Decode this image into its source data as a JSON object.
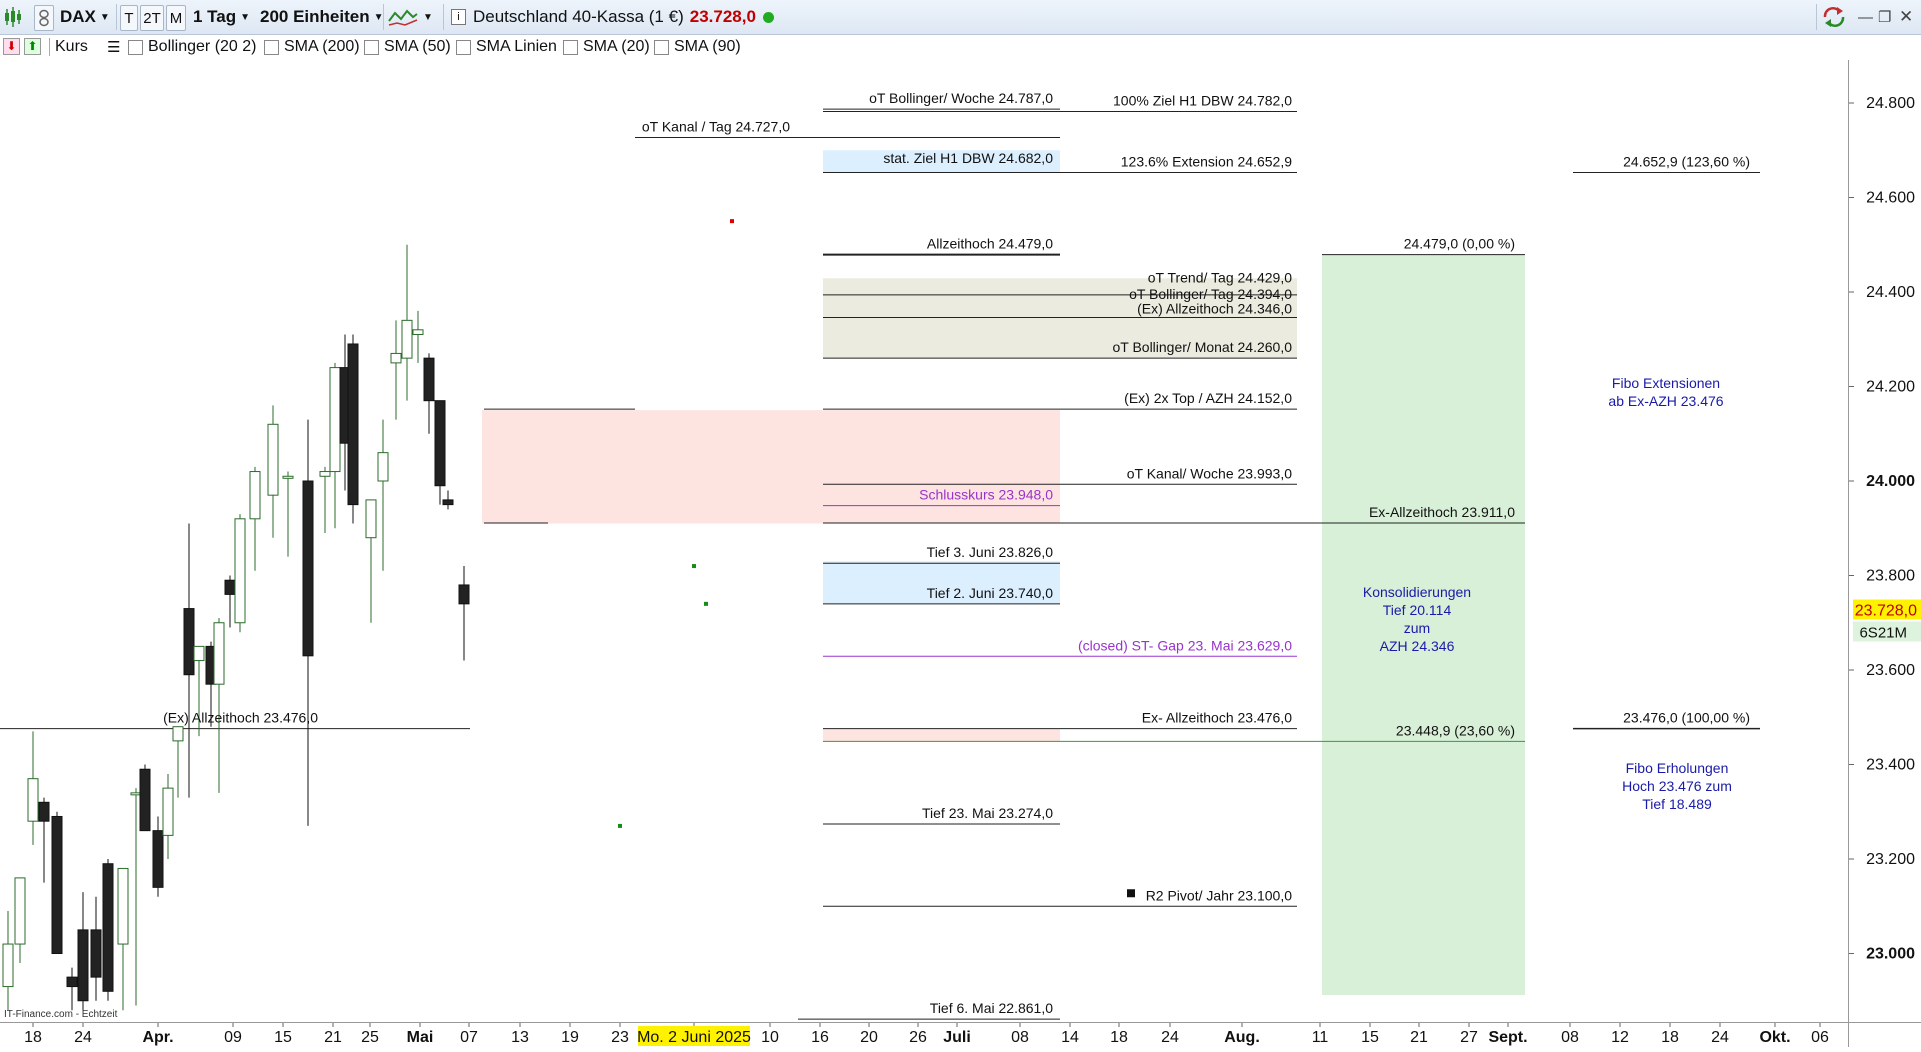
{
  "toolbar": {
    "symbol": "DAX",
    "btn_t": "T",
    "btn_2t": "2T",
    "btn_m": "M",
    "period": "1 Tag",
    "units": "200 Einheiten",
    "instrument": "Deutschland 40-Kassa (1 €)",
    "price": "23.728,0",
    "price_color": "#c00000",
    "status_color": "#22aa22"
  },
  "indicators": {
    "kurs": "Kurs",
    "items": [
      "Bollinger (20 2)",
      "SMA (200)",
      "SMA (50)",
      "SMA Linien",
      "SMA (20)",
      "SMA (90)"
    ]
  },
  "price_axis": {
    "ticks": [
      "24.800",
      "24.600",
      "24.400",
      "24.200",
      "24.000",
      "23.800",
      "23.600",
      "23.400",
      "23.200",
      "23.000"
    ],
    "bold_ticks": [
      "24.000",
      "23.000"
    ],
    "current_price": "23.728,0",
    "countdown": "6S21M"
  },
  "date_axis": {
    "labels": [
      "18",
      "24",
      "Apr.",
      "09",
      "15",
      "21",
      "25",
      "Mai",
      "07",
      "13",
      "19",
      "23",
      "Mo. 2 Juni 2025",
      "10",
      "16",
      "20",
      "26",
      "Juli",
      "08",
      "14",
      "18",
      "24",
      "Aug.",
      "11",
      "15",
      "21",
      "27",
      "Sept.",
      "08",
      "12",
      "18",
      "24",
      "Okt.",
      "06"
    ],
    "bold_labels": [
      "Apr.",
      "Mai",
      "Juli",
      "Aug.",
      "Sept.",
      "Okt."
    ],
    "highlight": "Mo. 2 Juni 2025"
  },
  "levels": {
    "oT_bollinger_woche": "oT Bollinger/ Woche 24.787,0",
    "ziel_100": "100% Ziel H1 DBW 24.782,0",
    "oT_kanal_tag": "oT Kanal / Tag 24.727,0",
    "stat_ziel": "stat. Ziel H1 DBW 24.682,0",
    "ext_1236": "123.6% Extension 24.652,9",
    "fibo_ext_1236": "24.652,9 (123,60 %)",
    "allzeithoch": "Allzeithoch 24.479,0",
    "fibo_0": "24.479,0 (0,00 %)",
    "oT_trend_tag": "oT Trend/ Tag  24.429,0",
    "oT_bollinger_tag": "oT Bollinger/ Tag 24.394,0",
    "ex_allzeithoch_24346": "(Ex) Allzeithoch 24.346,0",
    "oT_bollinger_monat": "oT Bollinger/ Monat 24.260,0",
    "ex_2x_top": "(Ex) 2x Top / AZH 24.152,0",
    "oT_kanal_woche": "oT Kanal/ Woche 23.993,0",
    "schlusskurs": "Schlusskurs 23.948,0",
    "ex_allzeithoch_23911": "Ex-Allzeithoch 23.911,0",
    "tief_3_juni": "Tief 3. Juni 23.826,0",
    "tief_2_juni": "Tief 2. Juni 23.740,0",
    "gap": "(closed) ST- Gap 23. Mai 23.629,0",
    "ex_allzeithoch_left": "(Ex)  Allzeithoch 23.476,0",
    "ex_allzeithoch_23476": "Ex-  Allzeithoch  23.476,0",
    "fibo_100": "23.476,0 (100,00 %)",
    "fibo_2360": "23.448,9 (23,60 %)",
    "tief_23_mai": "Tief 23. Mai 23.274,0",
    "r2_pivot": "R2 Pivot/ Jahr 23.100,0",
    "tief_6_mai": "Tief 6. Mai 22.861,0"
  },
  "annotations": {
    "fibo_ext_1": "Fibo Extensionen",
    "fibo_ext_2": "ab Ex-AZH 23.476",
    "konsol_1": "Konsolidierungen",
    "konsol_2": "Tief 20.114",
    "konsol_3": "zum",
    "konsol_4": "AZH 24.346",
    "fibo_erh_1": "Fibo Erholungen",
    "fibo_erh_2": "Hoch 23.476 zum",
    "fibo_erh_3": "Tief 18.489",
    "watermark": "IT-Finance.com - Echtzeit"
  },
  "colors": {
    "purple": "#9933cc",
    "blue_text": "#1a1aaa",
    "green_zone": "#d8f0d8",
    "pink_zone": "#fde4e0",
    "beige_zone": "#ebebdf",
    "light_blue_zone": "#dcefff"
  },
  "chart_data": {
    "type": "candlestick",
    "y_range": [
      22880,
      24900
    ],
    "candles": [
      {
        "o": 22930,
        "h": 23090,
        "l": 22880,
        "c": 23020
      },
      {
        "o": 23020,
        "h": 23160,
        "l": 22980,
        "c": 23160
      },
      {
        "o": 23280,
        "h": 23470,
        "l": 23230,
        "c": 23370
      },
      {
        "o": 23320,
        "h": 23330,
        "l": 23150,
        "c": 23280
      },
      {
        "o": 23290,
        "h": 23300,
        "l": 23000,
        "c": 23000
      },
      {
        "o": 22950,
        "h": 22970,
        "l": 22880,
        "c": 22930
      },
      {
        "o": 23050,
        "h": 23130,
        "l": 22880,
        "c": 22900
      },
      {
        "o": 23050,
        "h": 23120,
        "l": 22900,
        "c": 22950
      },
      {
        "o": 23190,
        "h": 23200,
        "l": 22900,
        "c": 22920
      },
      {
        "o": 23020,
        "h": 23180,
        "l": 22880,
        "c": 23180
      },
      {
        "o": 23340,
        "h": 23350,
        "l": 22890,
        "c": 23340
      },
      {
        "o": 23390,
        "h": 23400,
        "l": 23260,
        "c": 23260
      },
      {
        "o": 23260,
        "h": 23290,
        "l": 23120,
        "c": 23140
      },
      {
        "o": 23250,
        "h": 23380,
        "l": 23200,
        "c": 23350
      },
      {
        "o": 23450,
        "h": 23480,
        "l": 23330,
        "c": 23480
      },
      {
        "o": 23730,
        "h": 23910,
        "l": 23330,
        "c": 23590
      },
      {
        "o": 23620,
        "h": 23650,
        "l": 23460,
        "c": 23650
      },
      {
        "o": 23650,
        "h": 23660,
        "l": 23480,
        "c": 23570
      },
      {
        "o": 23570,
        "h": 23710,
        "l": 23340,
        "c": 23700
      },
      {
        "o": 23790,
        "h": 23800,
        "l": 23690,
        "c": 23760
      },
      {
        "o": 23700,
        "h": 23930,
        "l": 23680,
        "c": 23920
      },
      {
        "o": 23920,
        "h": 24030,
        "l": 23810,
        "c": 24020
      },
      {
        "o": 23970,
        "h": 24160,
        "l": 23880,
        "c": 24120
      },
      {
        "o": 24010,
        "h": 24020,
        "l": 23840,
        "c": 24010
      },
      {
        "o": 24000,
        "h": 24130,
        "l": 23270,
        "c": 23630
      },
      {
        "o": 24010,
        "h": 24030,
        "l": 23890,
        "c": 24020
      },
      {
        "o": 24020,
        "h": 24250,
        "l": 23900,
        "c": 24240
      },
      {
        "o": 24240,
        "h": 24310,
        "l": 23980,
        "c": 24080
      },
      {
        "o": 24290,
        "h": 24310,
        "l": 23910,
        "c": 23950
      },
      {
        "o": 23880,
        "h": 23920,
        "l": 23700,
        "c": 23960
      },
      {
        "o": 24000,
        "h": 24130,
        "l": 23810,
        "c": 24060
      },
      {
        "o": 24250,
        "h": 24340,
        "l": 24130,
        "c": 24270
      },
      {
        "o": 24260,
        "h": 24500,
        "l": 24170,
        "c": 24340
      },
      {
        "o": 24310,
        "h": 24360,
        "l": 24250,
        "c": 24320
      },
      {
        "o": 24260,
        "h": 24270,
        "l": 24100,
        "c": 24170
      },
      {
        "o": 24170,
        "h": 24170,
        "l": 23950,
        "c": 23990
      },
      {
        "o": 23960,
        "h": 23980,
        "l": 23940,
        "c": 23950
      },
      {
        "o": 23780,
        "h": 23820,
        "l": 23620,
        "c": 23740
      }
    ]
  }
}
